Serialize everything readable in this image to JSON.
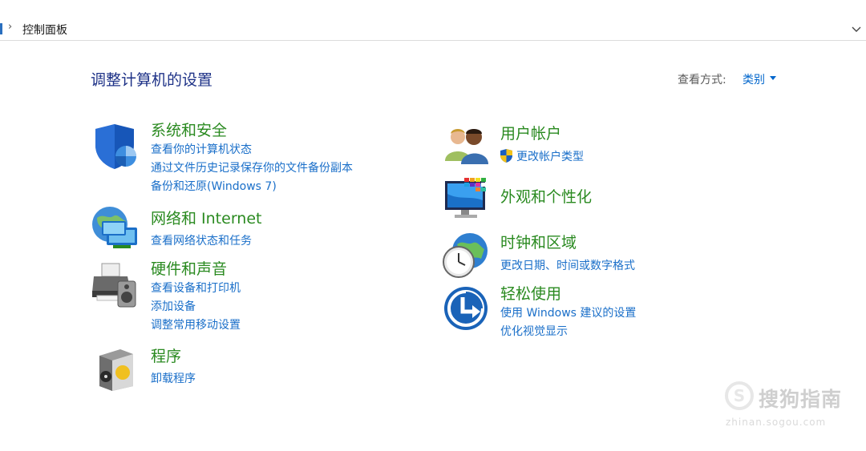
{
  "address": {
    "separator": "›",
    "path": "控制面板"
  },
  "header": {
    "title": "调整计算机的设置",
    "view_by_label": "查看方式:",
    "view_by_value": "类别"
  },
  "categories": {
    "system_security": {
      "title": "系统和安全",
      "icon": "shield-icon",
      "links": [
        "查看你的计算机状态",
        "通过文件历史记录保存你的文件备份副本",
        "备份和还原(Windows 7)"
      ]
    },
    "network": {
      "title": "网络和 Internet",
      "icon": "network-globe-icon",
      "links": [
        "查看网络状态和任务"
      ]
    },
    "hardware": {
      "title": "硬件和声音",
      "icon": "printer-speaker-icon",
      "links": [
        "查看设备和打印机",
        "添加设备",
        "调整常用移动设置"
      ]
    },
    "programs": {
      "title": "程序",
      "icon": "programs-box-icon",
      "links": [
        "卸载程序"
      ]
    },
    "user_accounts": {
      "title": "用户帐户",
      "icon": "users-icon",
      "links": [
        "更改帐户类型"
      ]
    },
    "appearance": {
      "title": "外观和个性化",
      "icon": "monitor-palette-icon",
      "links": []
    },
    "clock_region": {
      "title": "时钟和区域",
      "icon": "clock-globe-icon",
      "links": [
        "更改日期、时间或数字格式"
      ]
    },
    "ease_of_access": {
      "title": "轻松使用",
      "icon": "ease-of-access-icon",
      "links": [
        "使用 Windows 建议的设置",
        "优化视觉显示"
      ]
    }
  },
  "watermark": {
    "text": "搜狗指南",
    "sub": "zhinan.sogou.com"
  },
  "colors": {
    "title_blue": "#1e3287",
    "category_green": "#2a8a20",
    "link_blue": "#1a6fc9"
  }
}
